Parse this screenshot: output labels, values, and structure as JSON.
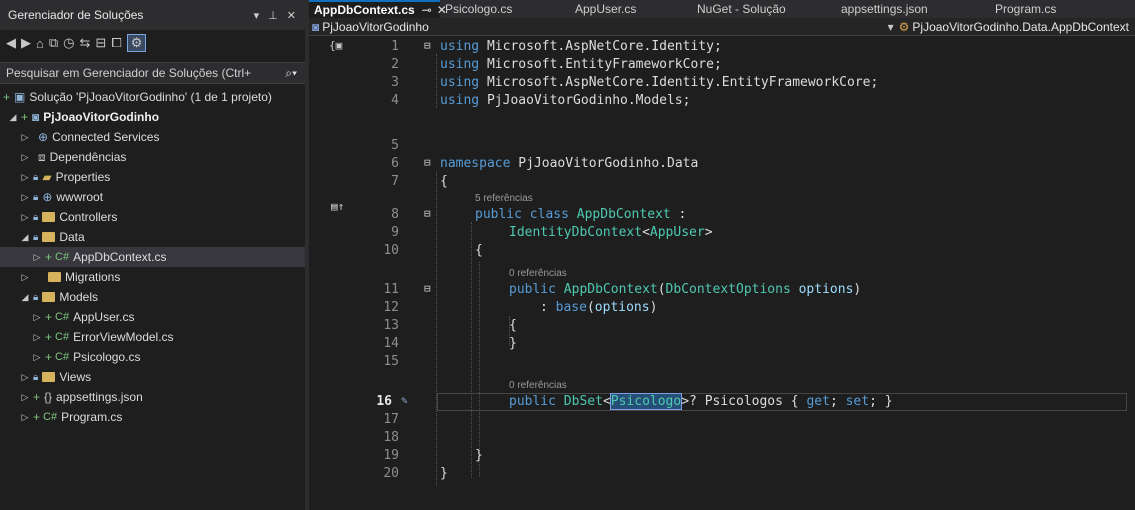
{
  "solution_explorer": {
    "title": "Gerenciador de Soluções",
    "title_controls": [
      "▾",
      "⊥",
      "✕"
    ],
    "toolbar_icons": [
      "back-icon",
      "forward-icon",
      "home-icon",
      "switch-views-icon",
      "history-icon",
      "sync-icon",
      "collapse-all-icon",
      "show-all-files-icon",
      "properties-icon"
    ],
    "search_placeholder": "Pesquisar em Gerenciador de Soluções (Ctrl+",
    "solution_label": "Solução 'PjJoaoVitorGodinho' (1 de 1 projeto)",
    "project": "PjJoaoVitorGodinho",
    "items": [
      {
        "label": "Connected Services",
        "icon": "connected-services-icon"
      },
      {
        "label": "Dependências",
        "icon": "dependencies-icon"
      },
      {
        "label": "Properties",
        "icon": "properties-folder-icon"
      },
      {
        "label": "wwwroot",
        "icon": "globe-icon"
      },
      {
        "label": "Controllers",
        "icon": "folder-icon"
      },
      {
        "label": "Data",
        "icon": "folder-icon"
      },
      {
        "label": "AppDbContext.cs",
        "icon": "csharp-file-icon"
      },
      {
        "label": "Migrations",
        "icon": "folder-icon"
      },
      {
        "label": "Models",
        "icon": "folder-icon"
      },
      {
        "label": "AppUser.cs",
        "icon": "csharp-file-icon"
      },
      {
        "label": "ErrorViewModel.cs",
        "icon": "csharp-file-icon"
      },
      {
        "label": "Psicologo.cs",
        "icon": "csharp-file-icon"
      },
      {
        "label": "Views",
        "icon": "folder-icon"
      },
      {
        "label": "appsettings.json",
        "icon": "json-file-icon"
      },
      {
        "label": "Program.cs",
        "icon": "csharp-file-icon"
      }
    ]
  },
  "tabs": [
    {
      "label": "AppDbContext.cs",
      "active": true
    },
    {
      "label": "Psicologo.cs"
    },
    {
      "label": "AppUser.cs"
    },
    {
      "label": "NuGet - Solução"
    },
    {
      "label": "appsettings.json"
    },
    {
      "label": "Program.cs"
    }
  ],
  "navbar": {
    "project": "PjJoaoVitorGodinho",
    "scope": "PjJoaoVitorGodinho.Data.AppDbContext"
  },
  "code": {
    "line_numbers": [
      "1",
      "2",
      "3",
      "4",
      "5",
      "6",
      "7",
      "8",
      "9",
      "10",
      "11",
      "12",
      "13",
      "14",
      "15",
      "16",
      "17",
      "18",
      "19",
      "20"
    ],
    "current_line": "16",
    "lines": {
      "l1_kw": "using",
      "l1_ns": " Microsoft.AspNetCore.Identity;",
      "l2_kw": "using",
      "l2_ns": " Microsoft.EntityFrameworkCore;",
      "l3_kw": "using",
      "l3_ns": " Microsoft.AspNetCore.Identity.EntityFrameworkCore;",
      "l4_kw": "using",
      "l4_ns": " PjJoaoVitorGodinho.Models;",
      "l6_kw": "namespace",
      "l6_ns": " PjJoaoVitorGodinho.Data",
      "l7": "{",
      "l8_kw1": "public",
      "l8_kw2": "class",
      "l8_ty": "AppDbContext",
      "l8_rest": " :",
      "l9_ty1": "IdentityDbContext",
      "l9_lt": "<",
      "l9_ty2": "AppUser",
      "l9_gt": ">",
      "l10": "{",
      "l11_kw": "public",
      "l11_fn": "AppDbContext",
      "l11_p1": "(",
      "l11_ty": "DbContextOptions",
      "l11_pm": "options",
      "l11_p2": ")",
      "l12_pre": ": ",
      "l12_kw": "base",
      "l12_p1": "(",
      "l12_pm": "options",
      "l12_p2": ")",
      "l13": "{",
      "l14": "}",
      "l16_kw": "public",
      "l16_ty": "DbSet",
      "l16_lt": "<",
      "l16_ty2": "Psicologo",
      "l16_rest": ">? Psicologos { ",
      "l16_get": "get",
      "l16_semi": "; ",
      "l16_set": "set",
      "l16_end": "; }",
      "l19": "}",
      "l20": "}"
    },
    "lens": {
      "class_refs": "5 referências",
      "ctor_refs": "0 referências",
      "prop_refs": "0 referências"
    }
  }
}
